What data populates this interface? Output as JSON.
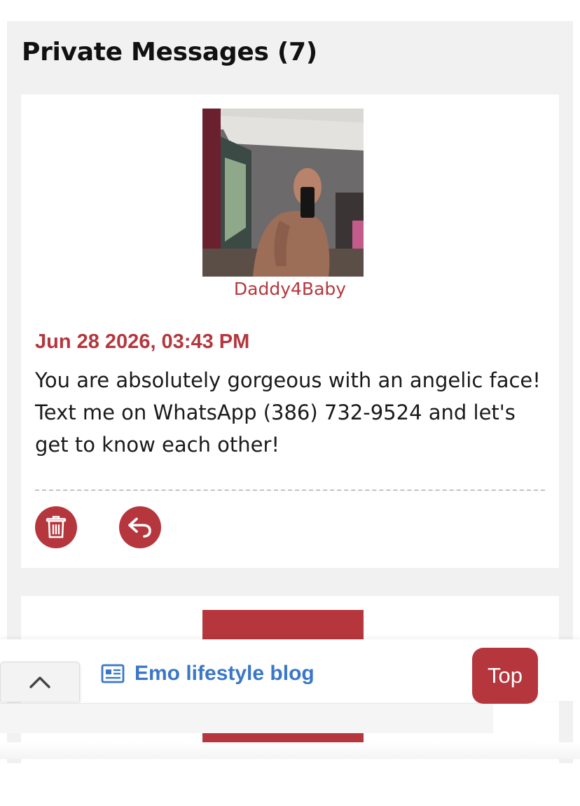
{
  "panel": {
    "title": "Private Messages (7)"
  },
  "messages": [
    {
      "username": "Daddy4Baby",
      "date": "Jun 28 2026, 03:43 PM",
      "body": "You are absolutely gorgeous with an angelic face! Text me on WhatsApp (386) 732-9524 and let's get to know each other!",
      "avatar_icon": "profile-photo",
      "actions": [
        {
          "name": "delete",
          "icon": "trash-icon"
        },
        {
          "name": "reply",
          "icon": "reply-arrow-icon"
        }
      ]
    }
  ],
  "overlay": {
    "collapse_icon": "chevron-up-icon",
    "blog_link": {
      "label": "Emo lifestyle blog",
      "icon": "newspaper-icon"
    },
    "top_button": "Top"
  },
  "colors": {
    "accent": "#b5373d",
    "link_blue": "#3a78c7",
    "panel_bg": "#f1f1f1",
    "card_bg": "#ffffff"
  }
}
